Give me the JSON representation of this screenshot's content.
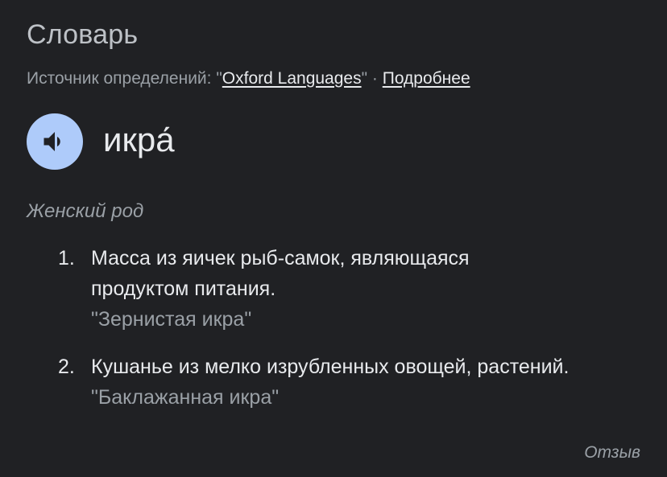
{
  "dictionary": {
    "title": "Словарь",
    "source_prefix": "Источник определений: \"",
    "source_link": "Oxford Languages",
    "source_suffix": "\" · ",
    "more_link": "Подробнее"
  },
  "entry": {
    "speaker_icon": "volume-icon",
    "accent_color": "#aecbfa",
    "headword": "икра́",
    "part_of_speech": "Женский род",
    "senses": [
      {
        "number": "1.",
        "definition_line1": "Масса из яичек рыб-самок, являющаяся",
        "definition_line2": "продуктом питания.",
        "example": "\"Зернистая икра\""
      },
      {
        "number": "2.",
        "definition_line1": "Кушанье из мелко изрубленных овощей, растений.",
        "example": "\"Баклажанная икра\""
      }
    ]
  },
  "footer": {
    "feedback_label": "Отзыв"
  }
}
